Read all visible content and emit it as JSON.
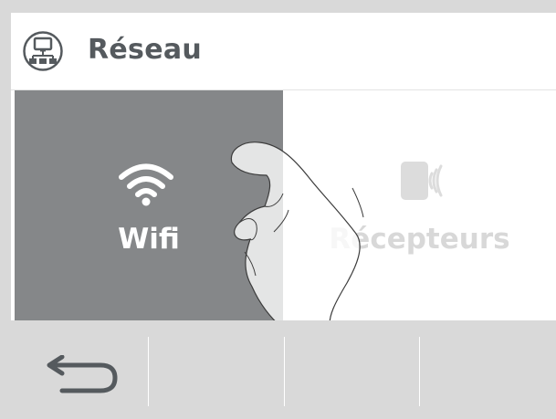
{
  "header": {
    "title": "Réseau",
    "icon": "network-icon"
  },
  "tiles": [
    {
      "label": "Wifi",
      "icon": "wifi-icon",
      "state": "pressed"
    },
    {
      "label": "Récepteurs",
      "icon": "receivers-icon",
      "state": "normal"
    }
  ],
  "bottom_bar": {
    "back_icon": "back-arrow-icon"
  },
  "colors": {
    "pressed_tile": "#858789",
    "title_text": "#555a5e",
    "bottom_bar": "#d9d9d9",
    "inactive_label": "#d8d8d8"
  }
}
